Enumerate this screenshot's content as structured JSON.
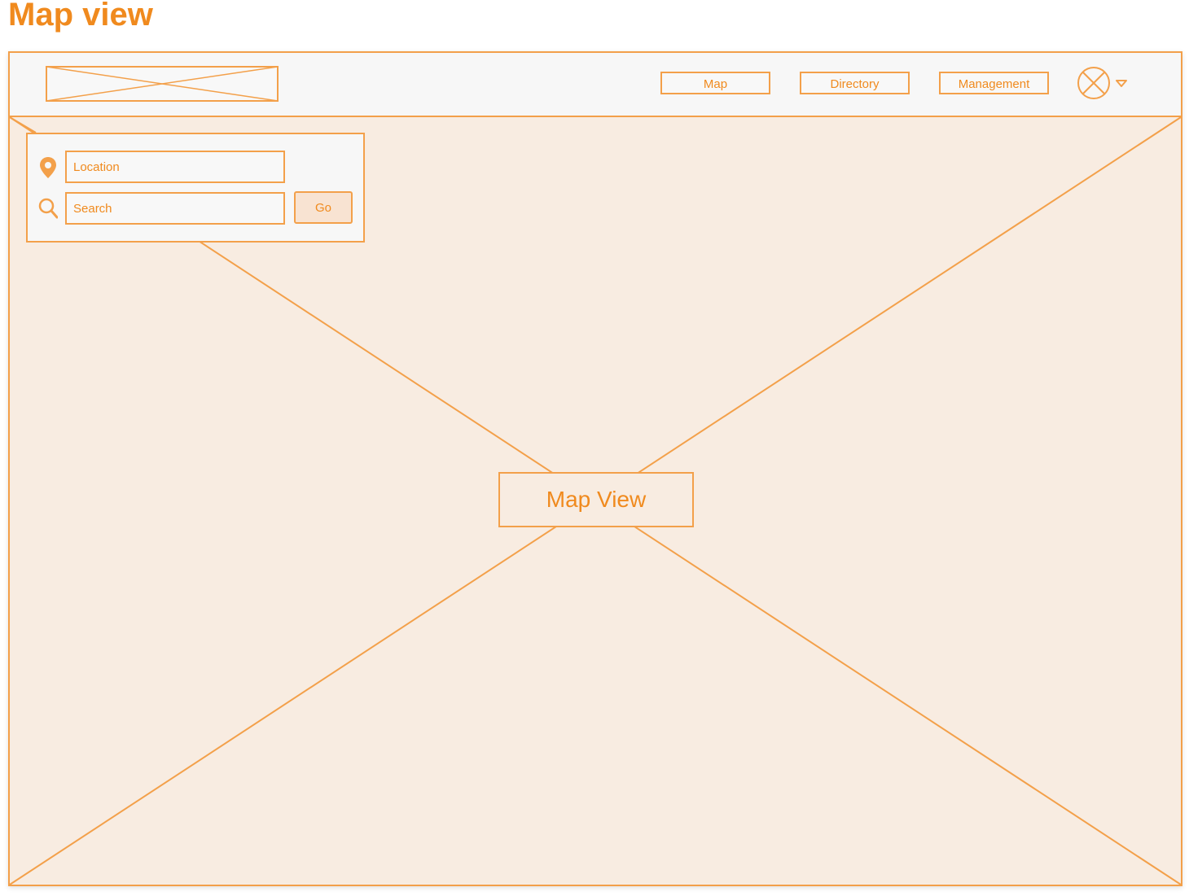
{
  "page": {
    "title": "Map view"
  },
  "header": {
    "nav": [
      {
        "label": "Map"
      },
      {
        "label": "Directory"
      },
      {
        "label": "Management"
      }
    ],
    "logo_icon": "image-placeholder-icon",
    "avatar_icon": "avatar-placeholder-icon",
    "dropdown_icon": "caret-down-icon"
  },
  "search_panel": {
    "location_placeholder": "Location",
    "location_icon": "map-pin-icon",
    "search_placeholder": "Search",
    "search_icon": "search-icon",
    "go_label": "Go"
  },
  "map": {
    "label": "Map View"
  },
  "colors": {
    "accent": "#f08a1e",
    "stroke": "#f3a04a",
    "map_fill": "#f8ece1",
    "header_fill": "#f7f7f7"
  }
}
